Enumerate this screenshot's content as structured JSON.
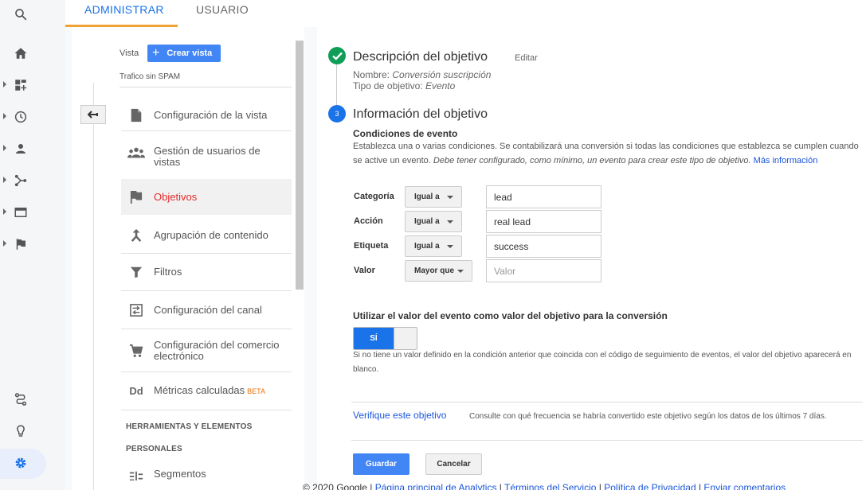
{
  "colors": {
    "accent": "#1a73e8",
    "active_menu": "#e52a2a",
    "tab_underline": "#f0a133",
    "success": "#0f9d58"
  },
  "rail": {
    "icons": [
      "search-icon",
      "home-icon",
      "dashboard-icon",
      "clock-icon",
      "person-icon",
      "acquisition-icon",
      "display-icon",
      "flag-icon",
      "route-icon",
      "lightbulb-icon",
      "gear-icon"
    ]
  },
  "tabs": {
    "admin": "ADMINISTRAR",
    "user": "USUARIO"
  },
  "view": {
    "label": "Vista",
    "create_button": "Crear vista",
    "name": "Trafico sin SPAM"
  },
  "menu": {
    "config_view": "Configuración de la vista",
    "user_mgmt_line1": "Gestión de usuarios de",
    "user_mgmt_line2": "vistas",
    "goals": "Objetivos",
    "content_grouping": "Agrupación de contenido",
    "filters": "Filtros",
    "channel_config": "Configuración del canal",
    "ecommerce_line1": "Configuración del comercio",
    "ecommerce_line2": "electrónico",
    "calc_metrics": "Métricas calculadas",
    "beta": "BETA",
    "tools_line1": "HERRAMIENTAS Y ELEMENTOS",
    "tools_line2": "PERSONALES",
    "segments": "Segmentos"
  },
  "goal": {
    "desc_title": "Descripción del objetivo",
    "edit": "Editar",
    "name_label": "Nombre:",
    "name_value": "Conversión suscripción",
    "type_label": "Tipo de objetivo:",
    "type_value": "Evento",
    "step_number": "3",
    "info_title": "Información del objetivo",
    "conditions_title": "Condiciones de evento",
    "conditions_desc": "Establezca una o varias condiciones. Se contabilizará una conversión si todas las condiciones que establezca se cumplen cuando se active un evento.",
    "conditions_italic": "Debe tener configurado, como mínimo, un evento para crear este tipo de objetivo.",
    "more_info": "Más información",
    "rows": [
      {
        "label": "Categoría",
        "operator": "Igual a",
        "value": "lead",
        "placeholder": ""
      },
      {
        "label": "Acción",
        "operator": "Igual a",
        "value": "real lead",
        "placeholder": ""
      },
      {
        "label": "Etiqueta",
        "operator": "Igual a",
        "value": "success",
        "placeholder": ""
      },
      {
        "label": "Valor",
        "operator": "Mayor que",
        "value": "",
        "placeholder": "Valor"
      }
    ],
    "use_value_title": "Utilizar el valor del evento como valor del objetivo para la conversión",
    "toggle_label": "SÍ",
    "toggle_note": "Si no tiene un valor definido en la condición anterior que coincida con el código de seguimiento de eventos, el valor del objetivo aparecerá en blanco.",
    "verify_link": "Verifique este objetivo",
    "verify_text": "Consulte con qué frecuencia se habría convertido este objetivo según los datos de los últimos 7 días.",
    "save": "Guardar",
    "cancel": "Cancelar"
  },
  "footer": {
    "copyright": "© 2020 Google",
    "links": [
      "Página principal de Analytics",
      "Términos del Servicio",
      "Política de Privacidad",
      "Enviar comentarios"
    ]
  }
}
